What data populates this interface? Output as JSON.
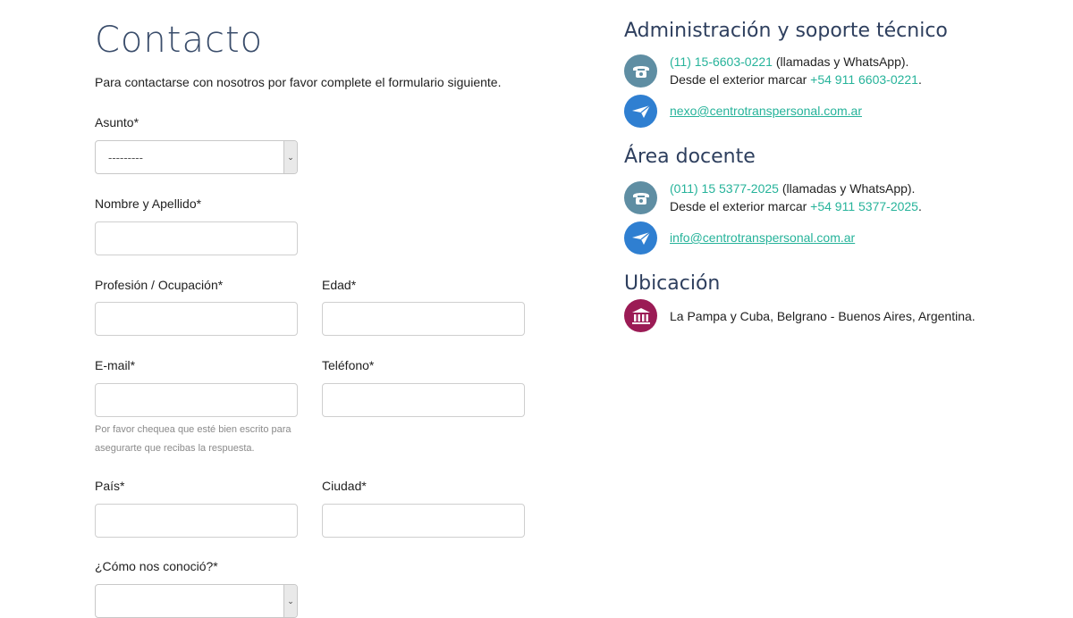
{
  "page": {
    "title": "Contacto",
    "intro": "Para contactarse con nosotros por favor complete el formulario siguiente."
  },
  "form": {
    "asunto_label": "Asunto*",
    "asunto_value": "---------",
    "nombre_label": "Nombre y Apellido*",
    "profesion_label": "Profesión / Ocupación*",
    "edad_label": "Edad*",
    "email_label": "E-mail*",
    "telefono_label": "Teléfono*",
    "email_hint": "Por favor chequea que esté bien escrito para asegurarte que recibas la respuesta.",
    "pais_label": "País*",
    "ciudad_label": "Ciudad*",
    "conocio_label": "¿Cómo nos conoció?*"
  },
  "admin": {
    "title": "Administración y soporte técnico",
    "phone": "(11) 15-6603-0221",
    "phone_suffix": " (llamadas y WhatsApp).",
    "exterior_prefix": "Desde el exterior marcar ",
    "exterior_phone": "+54 911 6603-0221",
    "exterior_suffix": ".",
    "email": "nexo@centrotranspersonal.com.ar"
  },
  "docente": {
    "title": "Área docente",
    "phone": "(011) 15 5377-2025",
    "phone_suffix": " (llamadas y WhatsApp).",
    "exterior_prefix": "Desde el exterior marcar ",
    "exterior_phone": "+54 911 5377-2025",
    "exterior_suffix": ".",
    "email": "info@centrotranspersonal.com.ar"
  },
  "ubicacion": {
    "title": "Ubicación",
    "address": "La Pampa y Cuba, Belgrano - Buenos Aires, Argentina."
  },
  "colors": {
    "accent": "#26b39a",
    "heading": "#2e3f5e",
    "phone_icon_bg": "#5f8ea3",
    "mail_icon_bg": "#2f7fd1",
    "location_icon_bg": "#9b1b55"
  },
  "icons": {
    "phone": "phone-icon",
    "mail": "mail-icon",
    "location": "bank-icon"
  }
}
